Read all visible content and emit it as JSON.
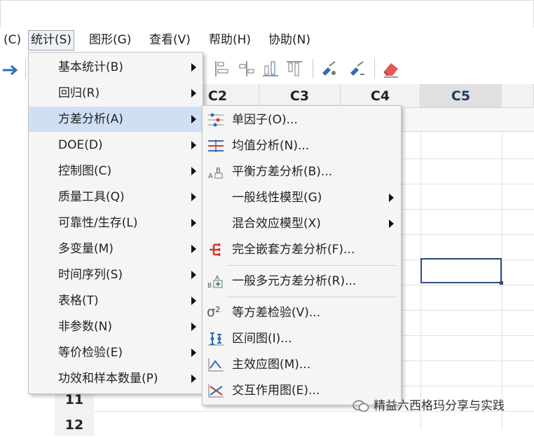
{
  "menubar": {
    "items": [
      {
        "label": "(C)"
      },
      {
        "label": "统计(S)"
      },
      {
        "label": "图形(G)"
      },
      {
        "label": "查看(V)"
      },
      {
        "label": "帮助(H)"
      },
      {
        "label": "协助(N)"
      }
    ]
  },
  "sheet": {
    "columns": [
      "C2",
      "C3",
      "C4",
      "C5"
    ],
    "rows": [
      "11",
      "12"
    ]
  },
  "stat_menu": {
    "items": [
      {
        "label": "基本统计(B)"
      },
      {
        "label": "回归(R)"
      },
      {
        "label": "方差分析(A)"
      },
      {
        "label": "DOE(D)"
      },
      {
        "label": "控制图(C)"
      },
      {
        "label": "质量工具(Q)"
      },
      {
        "label": "可靠性/生存(L)"
      },
      {
        "label": "多变量(M)"
      },
      {
        "label": "时间序列(S)"
      },
      {
        "label": "表格(T)"
      },
      {
        "label": "非参数(N)"
      },
      {
        "label": "等价检验(E)"
      },
      {
        "label": "功效和样本数量(P)"
      }
    ]
  },
  "anova_menu": {
    "items": [
      {
        "label": "单因子(O)..."
      },
      {
        "label": "均值分析(N)..."
      },
      {
        "label": "平衡方差分析(B)..."
      },
      {
        "label": "一般线性模型(G)"
      },
      {
        "label": "混合效应模型(X)"
      },
      {
        "label": "完全嵌套方差分析(F)..."
      },
      {
        "label": "一般多元方差分析(R)..."
      },
      {
        "label": "等方差检验(V)..."
      },
      {
        "label": "区间图(I)..."
      },
      {
        "label": "主效应图(M)..."
      },
      {
        "label": "交互作用图(E)..."
      }
    ],
    "icon_text": {
      "sigma": "σ²",
      "ab": "A",
      "abc": "B"
    }
  },
  "watermark": {
    "text": "精益六西格玛分享与实践"
  },
  "colors": {
    "highlight": "#cfe0f4",
    "active_border": "#2b4f7a",
    "red": "#d9342b",
    "blue": "#2f6db5"
  }
}
